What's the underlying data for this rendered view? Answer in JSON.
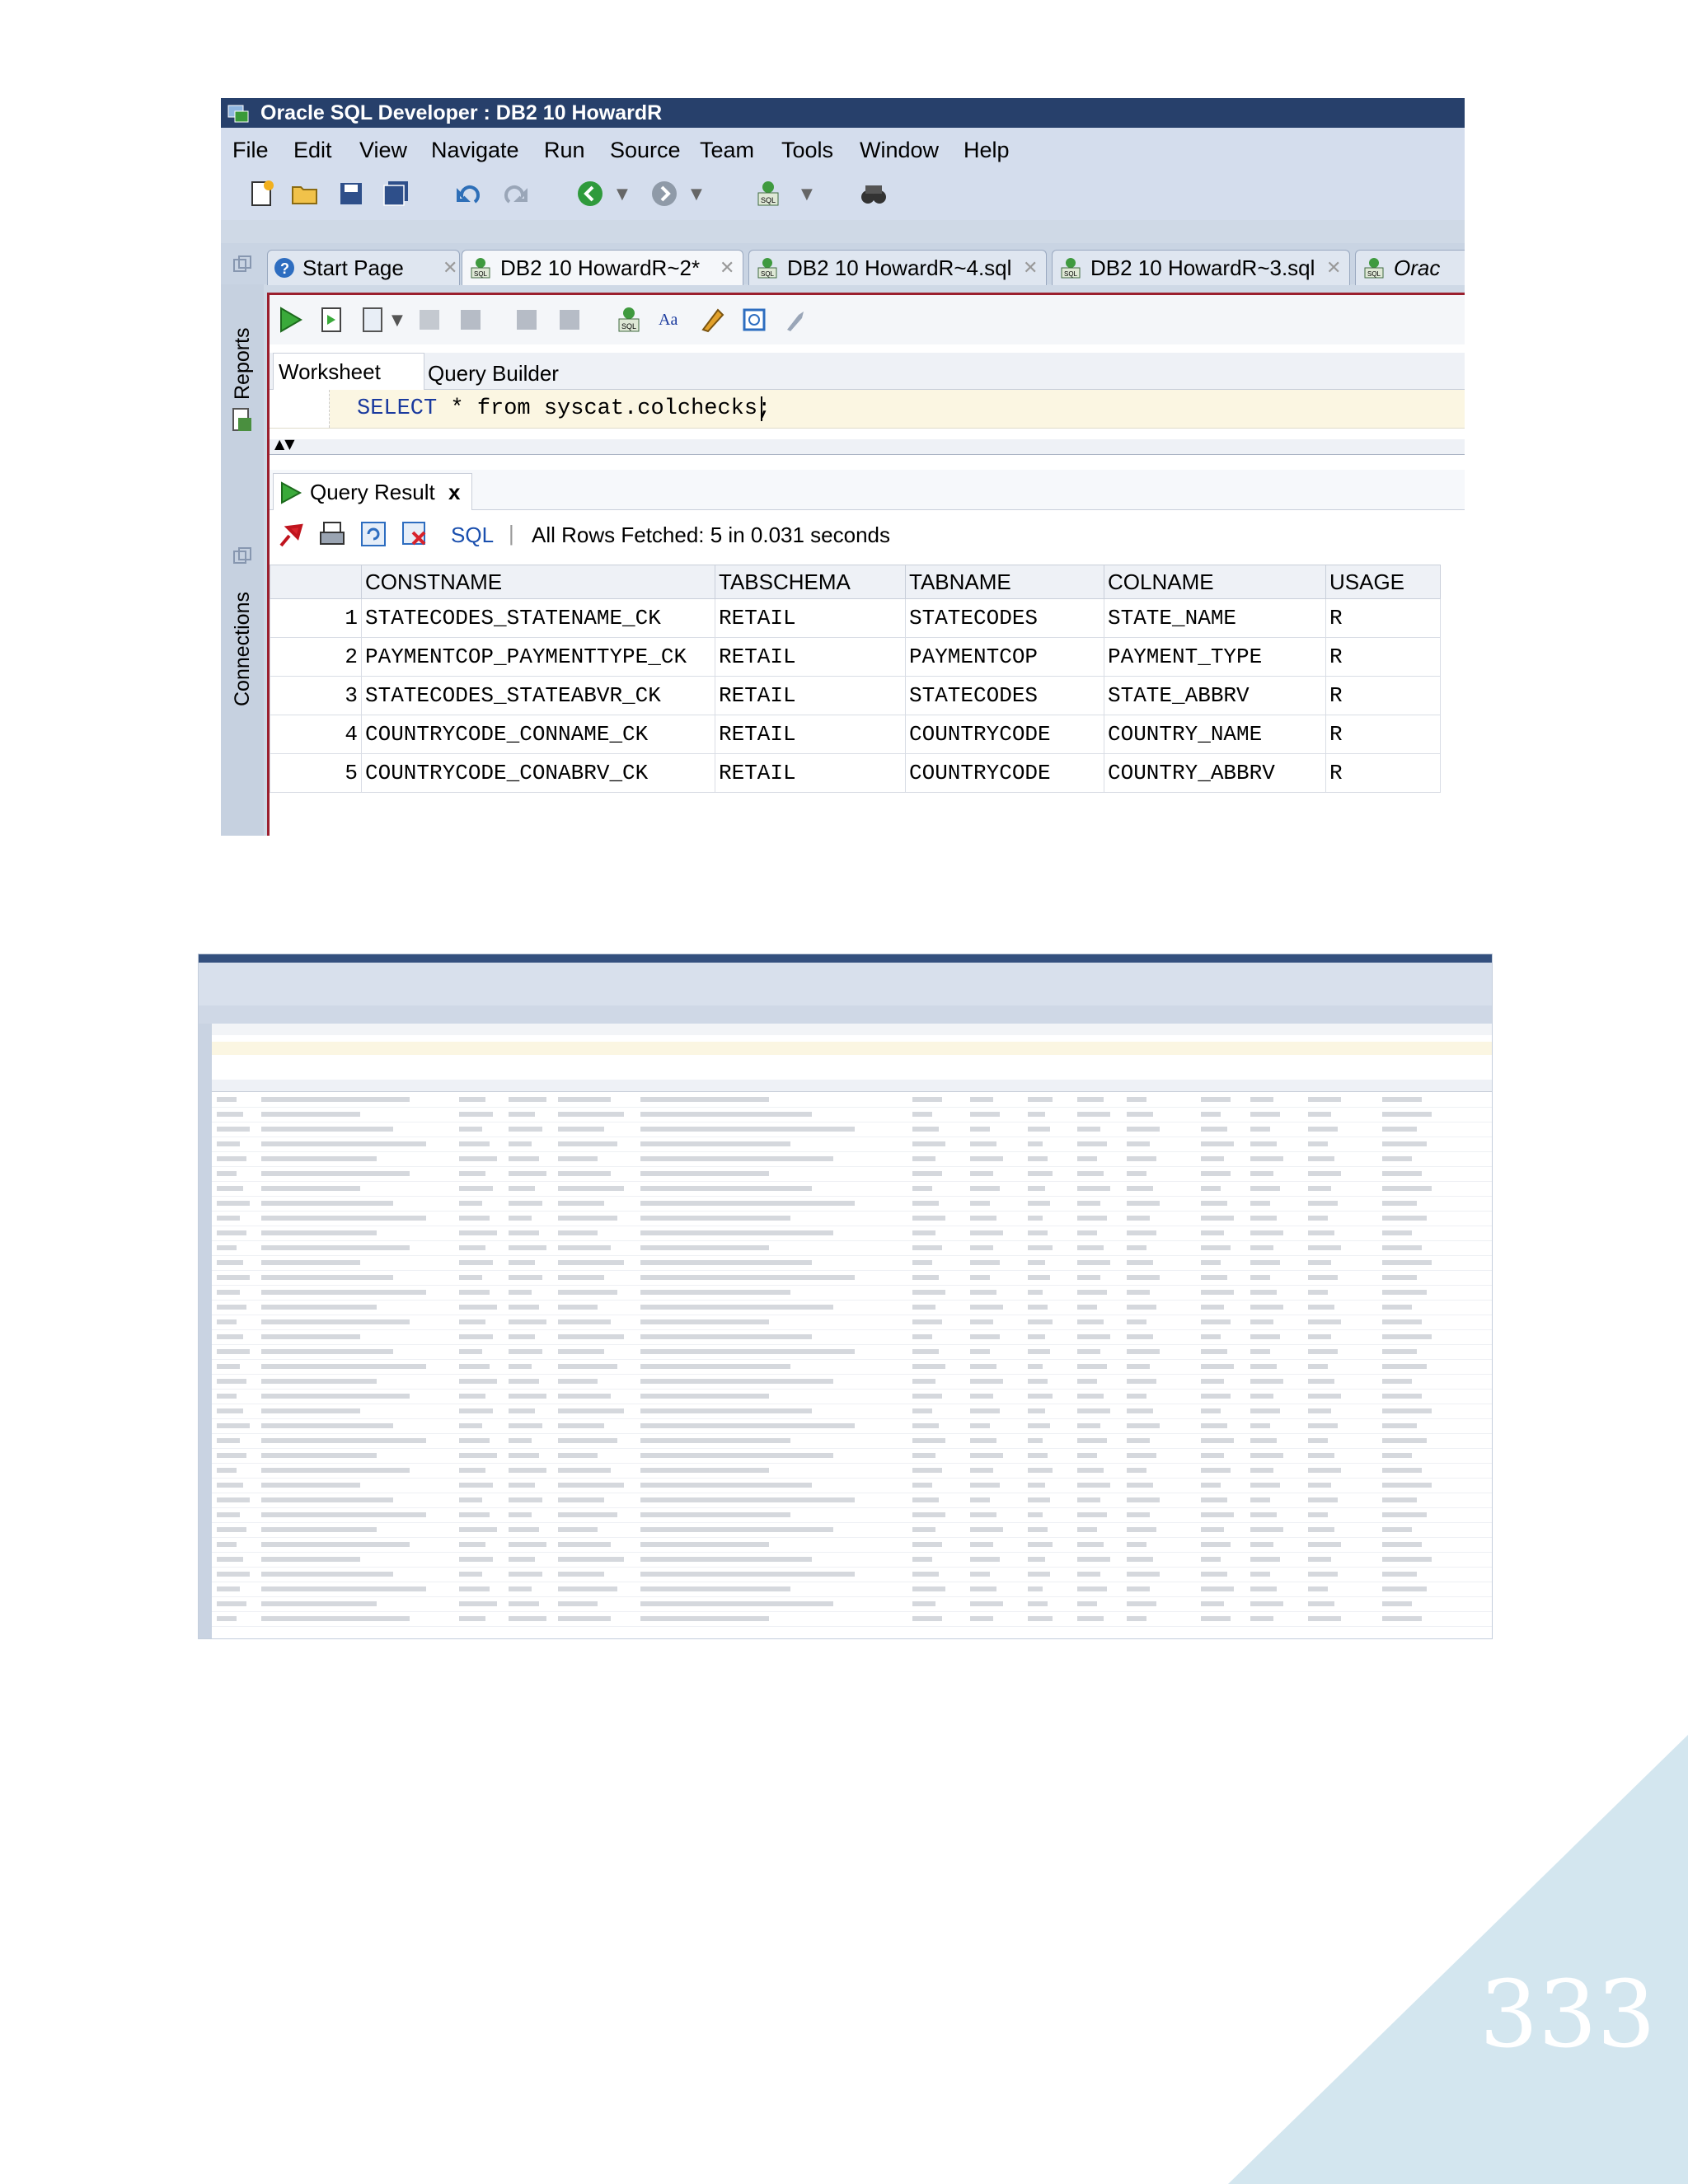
{
  "window": {
    "title": "Oracle SQL Developer : DB2 10 HowardR"
  },
  "menu": [
    "File",
    "Edit",
    "View",
    "Navigate",
    "Run",
    "Source",
    "Team",
    "Tools",
    "Window",
    "Help"
  ],
  "side_panels": {
    "reports": "Reports",
    "connections": "Connections"
  },
  "tabs": [
    {
      "label": "Start Page"
    },
    {
      "label": "DB2 10 HowardR~2*"
    },
    {
      "label": "DB2 10 HowardR~4.sql"
    },
    {
      "label": "DB2 10 HowardR~3.sql"
    },
    {
      "label": "Orac"
    }
  ],
  "worksheet": {
    "tabs": [
      "Worksheet",
      "Query Builder"
    ],
    "sql_keyword": "SELECT",
    "sql_rest": "  * from syscat.colchecks;"
  },
  "result": {
    "tab_label": "Query Result",
    "close_label": "x",
    "sql_link": "SQL",
    "status": "All Rows Fetched: 5 in 0.031 seconds",
    "columns": [
      "CONSTNAME",
      "TABSCHEMA",
      "TABNAME",
      "COLNAME",
      "USAGE"
    ],
    "rows": [
      {
        "n": "1",
        "cells": [
          "STATECODES_STATENAME_CK",
          "RETAIL",
          "STATECODES",
          "STATE_NAME",
          "R"
        ]
      },
      {
        "n": "2",
        "cells": [
          "PAYMENTCOP_PAYMENTTYPE_CK",
          "RETAIL",
          "PAYMENTCOP",
          "PAYMENT_TYPE",
          "R"
        ]
      },
      {
        "n": "3",
        "cells": [
          "STATECODES_STATEABVR_CK",
          "RETAIL",
          "STATECODES",
          "STATE_ABBRV",
          "R"
        ]
      },
      {
        "n": "4",
        "cells": [
          "COUNTRYCODE_CONNAME_CK",
          "RETAIL",
          "COUNTRYCODE",
          "COUNTRY_NAME",
          "R"
        ]
      },
      {
        "n": "5",
        "cells": [
          "COUNTRYCODE_CONABRV_CK",
          "RETAIL",
          "COUNTRYCODE",
          "COUNTRY_ABBRV",
          "R"
        ]
      }
    ]
  },
  "page_number": "333",
  "colors": {
    "titlebar": "#27406b",
    "accent_border": "#9b1f2e",
    "corner": "#d3e6ef"
  }
}
